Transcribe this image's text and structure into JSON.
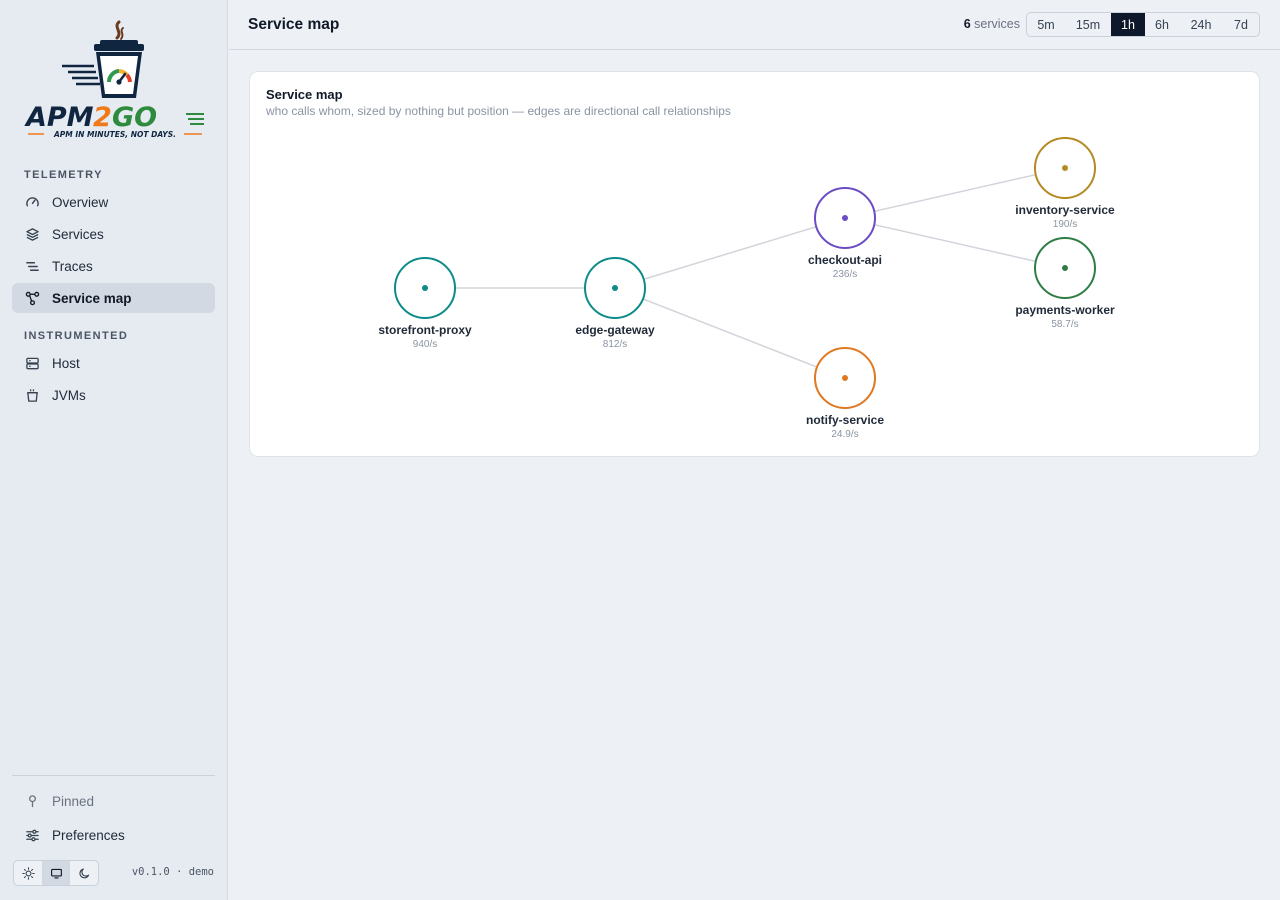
{
  "app": {
    "logo_text": "APM2GO",
    "logo_tagline": "APM IN MINUTES, NOT DAYS.",
    "version": "v0.1.0 · demo"
  },
  "sidebar": {
    "sections": [
      {
        "heading": "TELEMETRY",
        "items": [
          {
            "label": "Overview",
            "icon": "gauge-icon"
          },
          {
            "label": "Services",
            "icon": "layers-icon"
          },
          {
            "label": "Traces",
            "icon": "trace-list-icon"
          },
          {
            "label": "Service map",
            "icon": "graph-icon",
            "active": true
          }
        ]
      },
      {
        "heading": "INSTRUMENTED",
        "items": [
          {
            "label": "Host",
            "icon": "server-icon"
          },
          {
            "label": "JVMs",
            "icon": "coffee-cup-icon"
          }
        ]
      }
    ],
    "footer": {
      "pinned_label": "Pinned",
      "preferences_label": "Preferences",
      "theme_options": [
        "light",
        "system",
        "dark"
      ],
      "theme_selected": "system"
    }
  },
  "header": {
    "title": "Service map",
    "service_count": "6",
    "service_count_label": "services",
    "time_ranges": [
      "5m",
      "15m",
      "1h",
      "6h",
      "24h",
      "7d"
    ],
    "time_range_selected": "1h"
  },
  "service_map": {
    "title": "Service map",
    "subtitle": "who calls whom, sized by nothing but position — edges are directional call relationships",
    "nodes": [
      {
        "id": "storefront-proxy",
        "name": "storefront-proxy",
        "rate": "940/s",
        "color": "#0f8a8a"
      },
      {
        "id": "edge-gateway",
        "name": "edge-gateway",
        "rate": "812/s",
        "color": "#0f8a8a"
      },
      {
        "id": "checkout-api",
        "name": "checkout-api",
        "rate": "236/s",
        "color": "#6b4cc4"
      },
      {
        "id": "inventory-service",
        "name": "inventory-service",
        "rate": "190/s",
        "color": "#b58a24"
      },
      {
        "id": "payments-worker",
        "name": "payments-worker",
        "rate": "58.7/s",
        "color": "#2f7d45"
      },
      {
        "id": "notify-service",
        "name": "notify-service",
        "rate": "24.9/s",
        "color": "#e07a22"
      }
    ],
    "edges": [
      {
        "from": "storefront-proxy",
        "to": "edge-gateway"
      },
      {
        "from": "edge-gateway",
        "to": "checkout-api"
      },
      {
        "from": "edge-gateway",
        "to": "notify-service"
      },
      {
        "from": "checkout-api",
        "to": "inventory-service"
      },
      {
        "from": "checkout-api",
        "to": "payments-worker"
      }
    ],
    "edge_color": "#d1d5db"
  }
}
